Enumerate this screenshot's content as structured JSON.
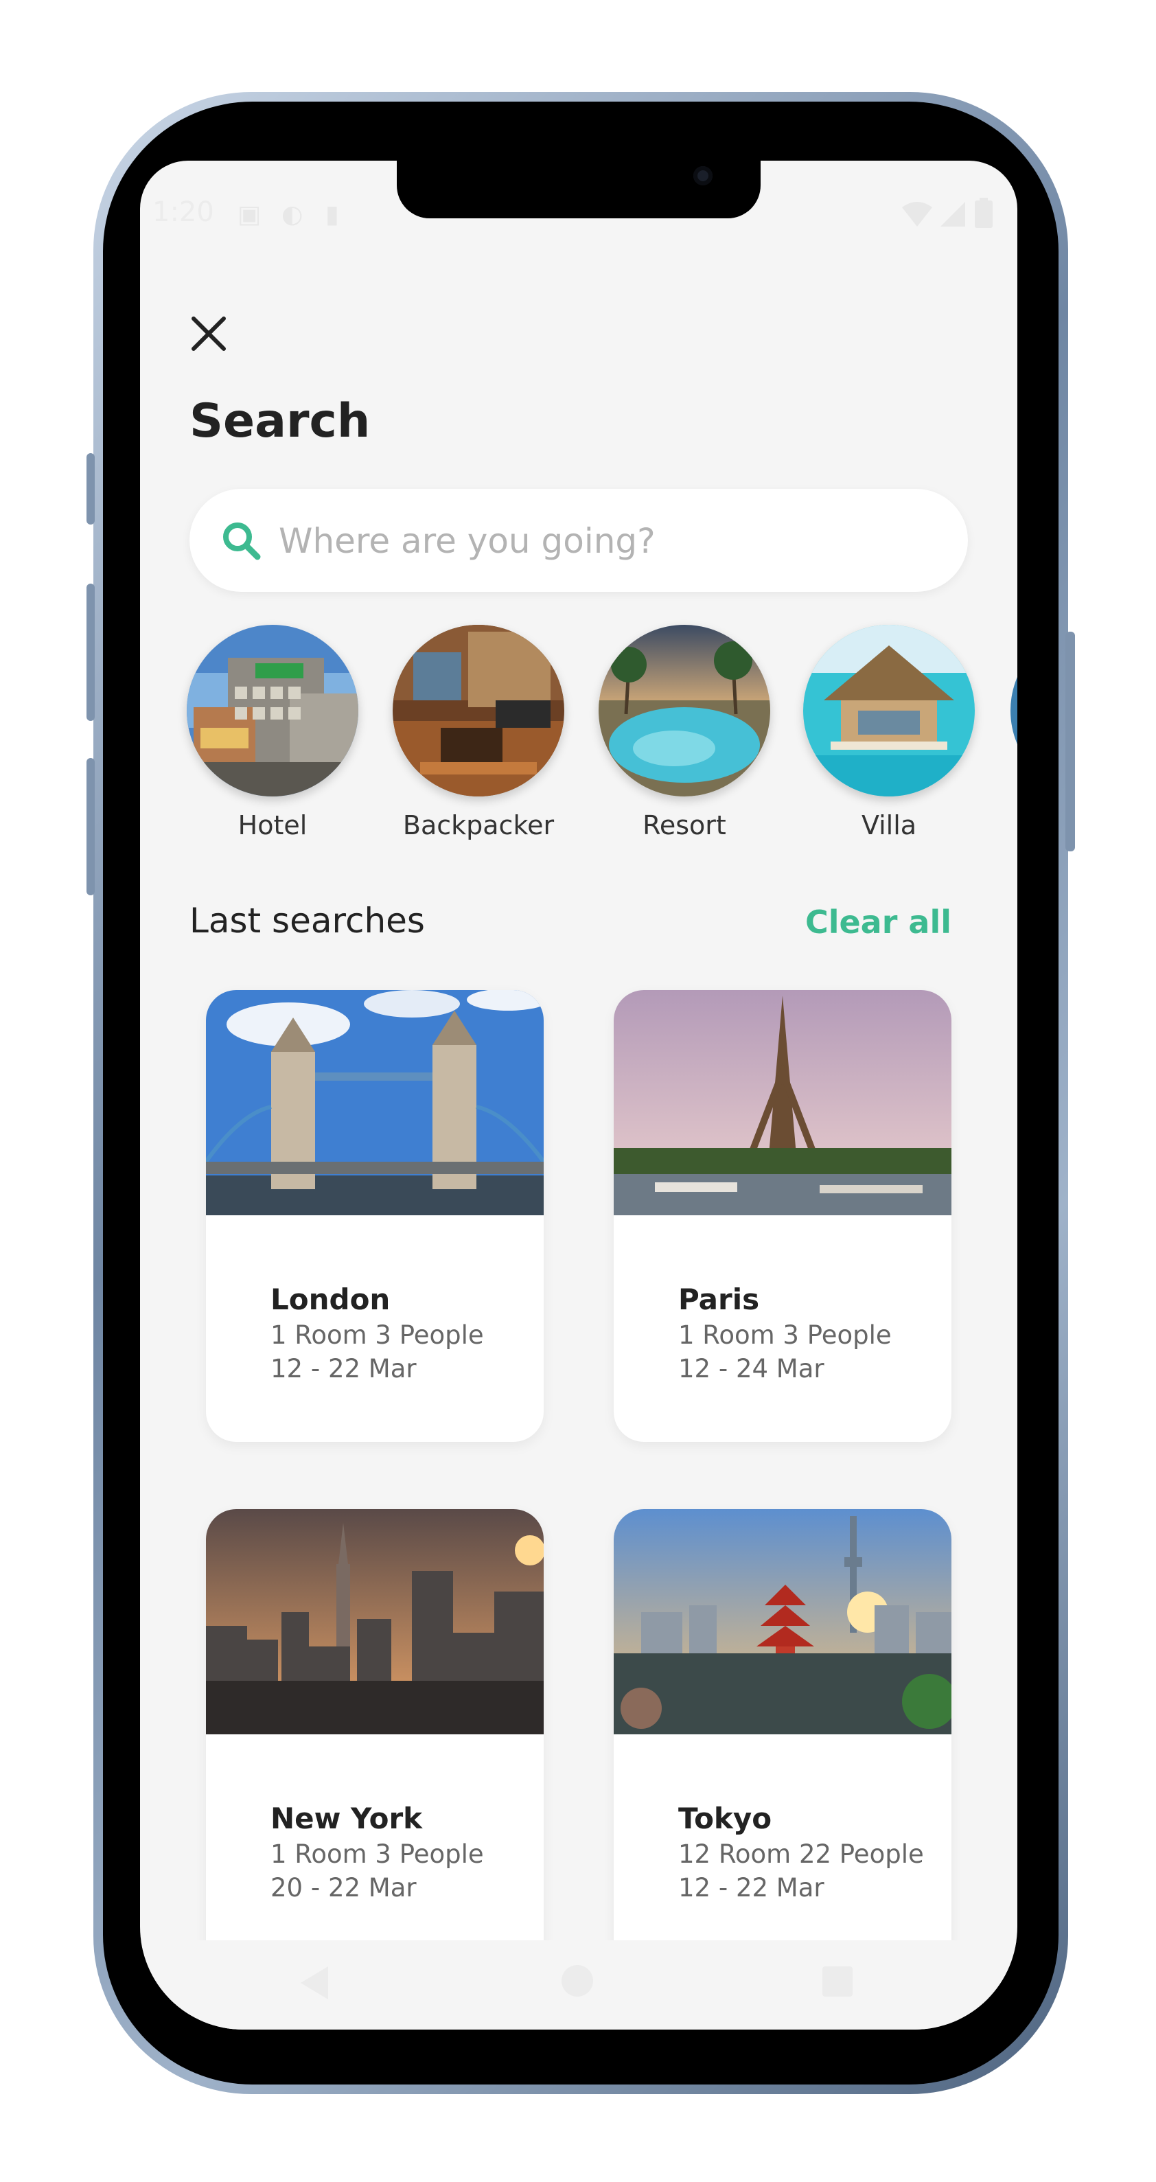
{
  "status_bar": {
    "time": "1:20"
  },
  "header": {
    "title": "Search"
  },
  "search": {
    "placeholder": "Where are you going?"
  },
  "categories": [
    {
      "label": "Hotel",
      "icon": "hotel-photo"
    },
    {
      "label": "Backpacker",
      "icon": "hostel-photo"
    },
    {
      "label": "Resort",
      "icon": "resort-pool-photo"
    },
    {
      "label": "Villa",
      "icon": "water-villa-photo"
    }
  ],
  "last_searches": {
    "title": "Last searches",
    "clear_label": "Clear all",
    "items": [
      {
        "city": "London",
        "details": "1 Room 3 People",
        "dates": "12 - 22 Mar"
      },
      {
        "city": "Paris",
        "details": "1 Room 3 People",
        "dates": "12 - 24 Mar"
      },
      {
        "city": "New York",
        "details": "1 Room 3 People",
        "dates": "20 - 22 Mar"
      },
      {
        "city": "Tokyo",
        "details": "12 Room 22 People",
        "dates": "12 - 22 Mar"
      }
    ]
  },
  "colors": {
    "accent": "#3dba90",
    "background": "#f5f5f5",
    "text": "#222222"
  }
}
